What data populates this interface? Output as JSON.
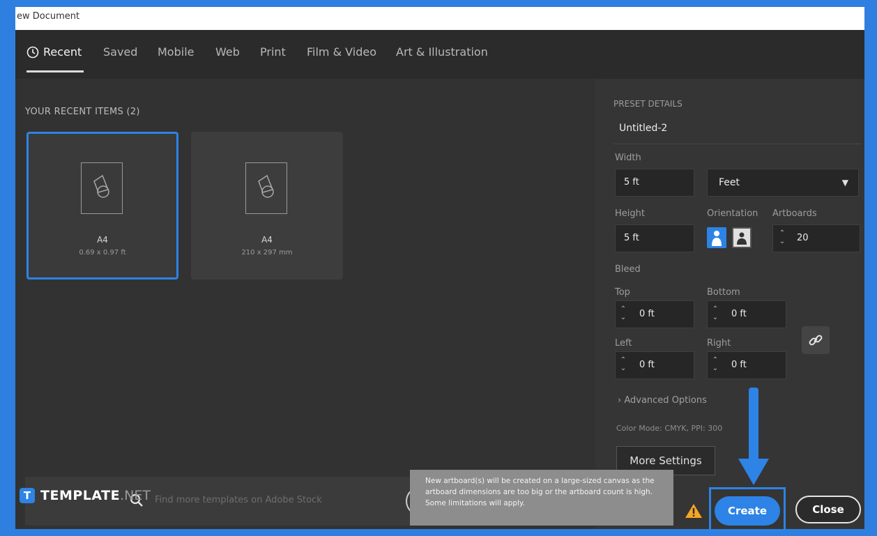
{
  "window": {
    "title": "ew Document"
  },
  "tabs": [
    {
      "label": "Recent"
    },
    {
      "label": "Saved"
    },
    {
      "label": "Mobile"
    },
    {
      "label": "Web"
    },
    {
      "label": "Print"
    },
    {
      "label": "Film & Video"
    },
    {
      "label": "Art & Illustration"
    }
  ],
  "recent": {
    "heading": "YOUR RECENT ITEMS (2)",
    "items": [
      {
        "title": "A4",
        "size": "0.69 x 0.97 ft"
      },
      {
        "title": "A4",
        "size": "210 x 297 mm"
      }
    ]
  },
  "search": {
    "placeholder": "Find more templates on Adobe Stock"
  },
  "watermark": {
    "badge": "T",
    "text": "TEMPLATE",
    "suffix": ".NET"
  },
  "preset": {
    "heading": "PRESET DETAILS",
    "name": "Untitled-2",
    "width_label": "Width",
    "width_value": "5 ft",
    "unit": "Feet",
    "height_label": "Height",
    "height_value": "5 ft",
    "orientation_label": "Orientation",
    "artboards_label": "Artboards",
    "artboards_value": "20",
    "bleed_label": "Bleed",
    "top_label": "Top",
    "top_value": "0 ft",
    "bottom_label": "Bottom",
    "bottom_value": "0 ft",
    "left_label": "Left",
    "left_value": "0 ft",
    "right_label": "Right",
    "right_value": "0 ft",
    "advanced": "Advanced Options",
    "color_mode": "Color Mode: CMYK,  PPI: 300",
    "more_settings": "More Settings"
  },
  "tooltip": {
    "text": "New artboard(s) will be created on a large-sized canvas as the artboard dimensions are too big or the artboard count is high. Some limitations will apply."
  },
  "actions": {
    "create": "Create",
    "close": "Close"
  },
  "colors": {
    "accent": "#2d83e6",
    "panel": "#323232",
    "warning": "#f5a623"
  }
}
